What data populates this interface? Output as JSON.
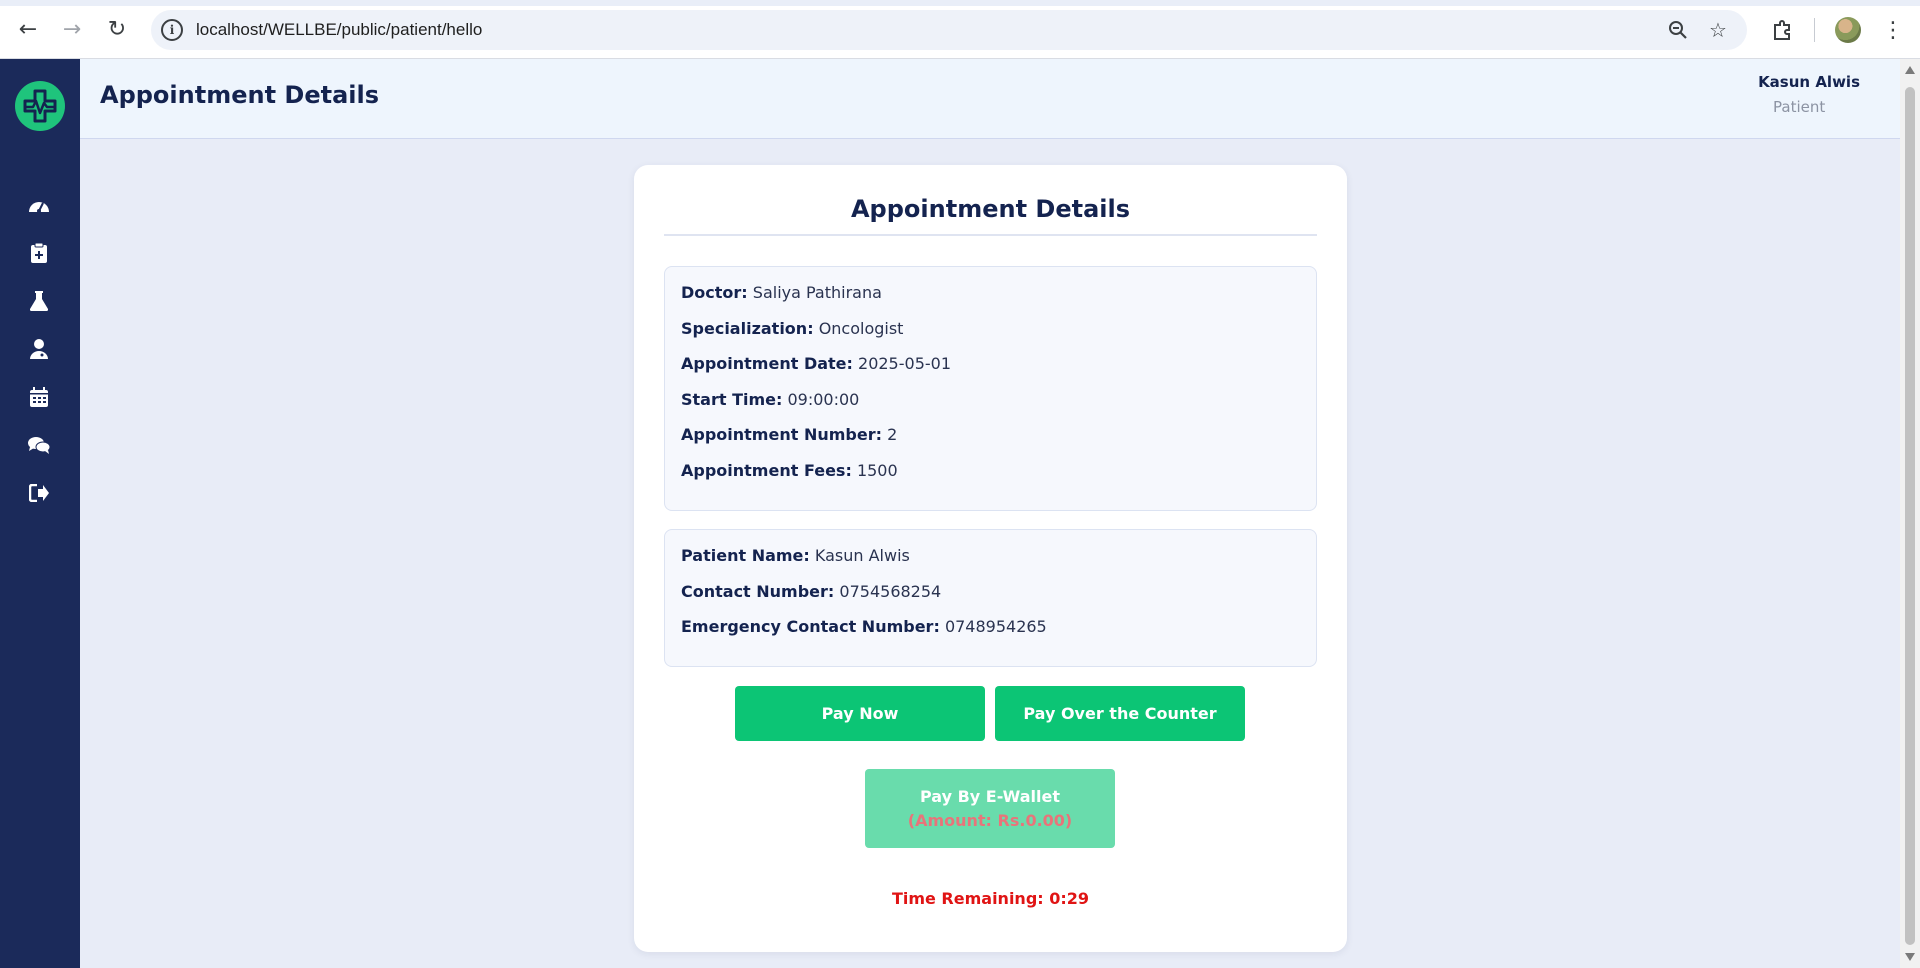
{
  "browser": {
    "url": "localhost/WELLBE/public/patient/hello"
  },
  "header": {
    "title": "Appointment Details",
    "user_name": "Kasun Alwis",
    "user_role": "Patient"
  },
  "sidebar": {
    "items": [
      {
        "icon": "dashboard-icon"
      },
      {
        "icon": "clipboard-medical-icon"
      },
      {
        "icon": "flask-icon"
      },
      {
        "icon": "doctor-icon"
      },
      {
        "icon": "calendar-icon"
      },
      {
        "icon": "chat-icon"
      },
      {
        "icon": "logout-icon"
      }
    ]
  },
  "card": {
    "title": "Appointment Details",
    "appointment": {
      "doctor_label": "Doctor:",
      "doctor": "Saliya Pathirana",
      "specialization_label": "Specialization:",
      "specialization": "Oncologist",
      "date_label": "Appointment Date:",
      "date": "2025-05-01",
      "start_label": "Start Time:",
      "start": "09:00:00",
      "number_label": "Appointment Number:",
      "number": "2",
      "fees_label": "Appointment Fees:",
      "fees": "1500"
    },
    "patient": {
      "name_label": "Patient Name:",
      "name": "Kasun Alwis",
      "contact_label": "Contact Number:",
      "contact": "0754568254",
      "emergency_label": "Emergency Contact Number:",
      "emergency": "0748954265"
    },
    "buttons": {
      "pay_now": "Pay Now",
      "pay_counter": "Pay Over the Counter",
      "ewallet": "Pay By E-Wallet",
      "ewallet_amount": "(Amount: Rs.0.00)"
    },
    "timer": "Time Remaining: 0:29"
  },
  "colors": {
    "sidebar": "#1b2a5a",
    "primary_button": "#0cc575",
    "disabled_button": "#69dcac",
    "timer": "#e01414",
    "heading": "#14234f"
  }
}
